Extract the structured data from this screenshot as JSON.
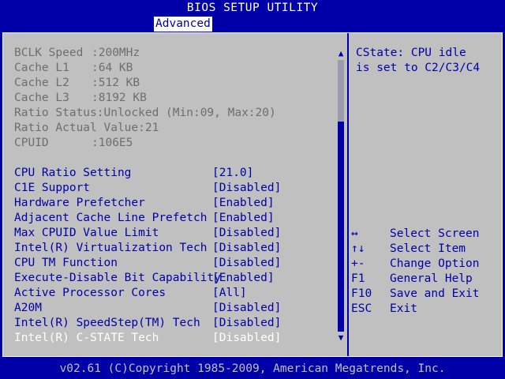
{
  "title": "BIOS SETUP UTILITY",
  "tabs": [
    {
      "label": "Advanced",
      "active": true
    }
  ],
  "info_items": [
    {
      "label": "BCLK Speed",
      "value": ":200MHz"
    },
    {
      "label": "Cache L1",
      "value": ":64 KB"
    },
    {
      "label": "Cache L2",
      "value": ":512 KB"
    },
    {
      "label": "Cache L3",
      "value": ":8192 KB"
    },
    {
      "label": "Ratio Status:Unlocked (Min:09, Max:20)",
      "value": ""
    },
    {
      "label": "Ratio Actual Value:21",
      "value": ""
    },
    {
      "label": "CPUID",
      "value": ":106E5"
    }
  ],
  "settings": [
    {
      "label": "CPU Ratio Setting",
      "value": "[21.0]"
    },
    {
      "label": "C1E Support",
      "value": "[Disabled]"
    },
    {
      "label": "Hardware Prefetcher",
      "value": "[Enabled]"
    },
    {
      "label": "Adjacent Cache Line Prefetch",
      "value": "[Enabled]"
    },
    {
      "label": "Max CPUID Value Limit",
      "value": "[Disabled]"
    },
    {
      "label": "Intel(R) Virtualization Tech",
      "value": "[Disabled]"
    },
    {
      "label": "CPU TM Function",
      "value": "[Disabled]"
    },
    {
      "label": "Execute-Disable Bit Capability",
      "value": "[Enabled]"
    },
    {
      "label": "Active Processor Cores",
      "value": "[All]"
    },
    {
      "label": "A20M",
      "value": "[Disabled]"
    },
    {
      "label": "Intel(R) SpeedStep(TM) Tech",
      "value": "[Disabled]"
    },
    {
      "label": "Intel(R) C-STATE Tech",
      "value": "[Disabled]",
      "selected": true
    }
  ],
  "scrollbar": {
    "up_arrow": "▲",
    "down_arrow": "▼"
  },
  "help": {
    "text": "CState: CPU idle\nis set to C2/C3/C4"
  },
  "keys": [
    {
      "key": "↔",
      "desc": "Select Screen"
    },
    {
      "key": "↑↓",
      "desc": "Select Item"
    },
    {
      "key": "+-",
      "desc": "Change Option"
    },
    {
      "key": "F1",
      "desc": "General Help"
    },
    {
      "key": "F10",
      "desc": "Save and Exit"
    },
    {
      "key": "ESC",
      "desc": "Exit"
    }
  ],
  "footer": "v02.61 (C)Copyright 1985-2009, American Megatrends, Inc.",
  "colors": {
    "background": "#0000a8",
    "panel": "#c0c0c0",
    "text_active": "#0000a8",
    "text_disabled": "#6e6e6e",
    "text_selected": "#ffffff"
  }
}
